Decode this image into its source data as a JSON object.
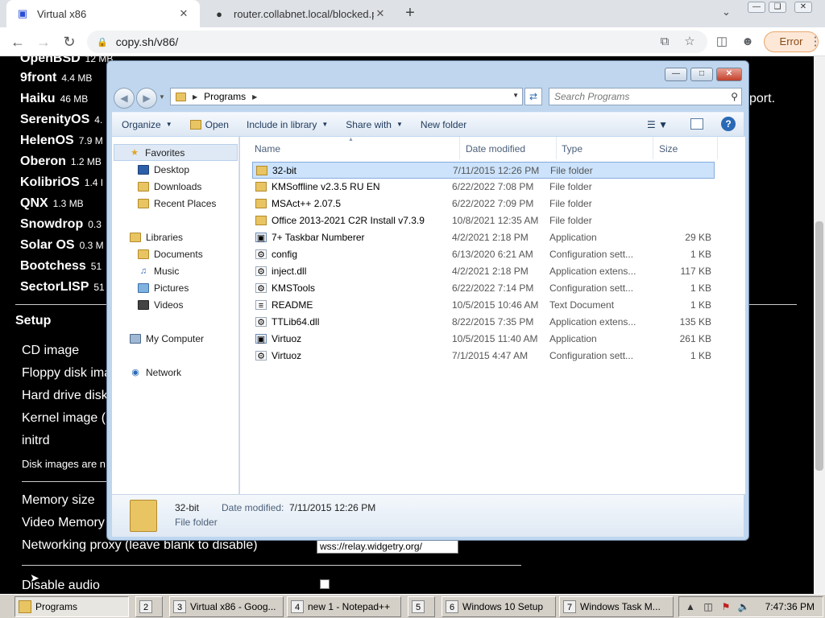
{
  "browser": {
    "tabs": [
      {
        "title": "Virtual x86",
        "favicon": "x86-icon"
      },
      {
        "title": "router.collabnet.local/blocked.ph",
        "favicon": "globe-icon"
      }
    ],
    "url": "copy.sh/v86/",
    "error_label": "Error"
  },
  "page": {
    "os_list": [
      {
        "name": "OpenBSD",
        "size": "12 MB"
      },
      {
        "name": "9front",
        "size": "4.4 MB"
      },
      {
        "name": "Haiku",
        "size": "46 MB"
      },
      {
        "name": "SerenityOS",
        "size": "4."
      },
      {
        "name": "HelenOS",
        "size": "7.9 M"
      },
      {
        "name": "Oberon",
        "size": "1.2 MB"
      },
      {
        "name": "KolibriOS",
        "size": "1.4 I"
      },
      {
        "name": "QNX",
        "size": "1.3 MB"
      },
      {
        "name": "Snowdrop",
        "size": "0.3"
      },
      {
        "name": "Solar OS",
        "size": "0.3 M"
      },
      {
        "name": "Bootchess",
        "size": "51"
      },
      {
        "name": "SectorLISP",
        "size": "51"
      }
    ],
    "right_fragment": "port.",
    "setup_heading": "Setup",
    "setup_rows": [
      "CD image",
      "Floppy disk ima",
      "Hard drive disk",
      "Kernel image (",
      "initrd",
      "Disk images are n",
      "Memory size",
      "Video Memory",
      "Networking proxy (leave blank to disable)",
      "Disable audio"
    ],
    "proxy_value": "wss://relay.widgetry.org/"
  },
  "explorer": {
    "breadcrumb": "Programs",
    "search_placeholder": "Search Programs",
    "commands": [
      "Organize",
      "Open",
      "Include in library",
      "Share with",
      "New folder"
    ],
    "nav": {
      "favorites": "Favorites",
      "desktop": "Desktop",
      "downloads": "Downloads",
      "recent": "Recent Places",
      "libraries": "Libraries",
      "documents": "Documents",
      "music": "Music",
      "pictures": "Pictures",
      "videos": "Videos",
      "computer": "My Computer",
      "network": "Network"
    },
    "columns": {
      "name": "Name",
      "date": "Date modified",
      "type": "Type",
      "size": "Size"
    },
    "files": [
      {
        "name": "32-bit",
        "date": "7/11/2015 12:26 PM",
        "type": "File folder",
        "size": "",
        "icon": "folder-icon"
      },
      {
        "name": "KMSoffline v2.3.5 RU EN",
        "date": "6/22/2022 7:08 PM",
        "type": "File folder",
        "size": "",
        "icon": "folder-icon"
      },
      {
        "name": "MSAct++ 2.07.5",
        "date": "6/22/2022 7:09 PM",
        "type": "File folder",
        "size": "",
        "icon": "folder-icon"
      },
      {
        "name": "Office 2013-2021 C2R Install v7.3.9",
        "date": "10/8/2021 12:35 AM",
        "type": "File folder",
        "size": "",
        "icon": "folder-icon"
      },
      {
        "name": "7+ Taskbar Numberer",
        "date": "4/2/2021 2:18 PM",
        "type": "Application",
        "size": "29 KB",
        "icon": "app-icon"
      },
      {
        "name": "config",
        "date": "6/13/2020 6:21 AM",
        "type": "Configuration sett...",
        "size": "1 KB",
        "icon": "settings-file-icon"
      },
      {
        "name": "inject.dll",
        "date": "4/2/2021 2:18 PM",
        "type": "Application extens...",
        "size": "117 KB",
        "icon": "dll-icon"
      },
      {
        "name": "KMSTools",
        "date": "6/22/2022 7:14 PM",
        "type": "Configuration sett...",
        "size": "1 KB",
        "icon": "settings-file-icon"
      },
      {
        "name": "README",
        "date": "10/5/2015 10:46 AM",
        "type": "Text Document",
        "size": "1 KB",
        "icon": "text-file-icon"
      },
      {
        "name": "TTLib64.dll",
        "date": "8/22/2015 7:35 PM",
        "type": "Application extens...",
        "size": "135 KB",
        "icon": "dll-icon"
      },
      {
        "name": "Virtuoz",
        "date": "10/5/2015 11:40 AM",
        "type": "Application",
        "size": "261 KB",
        "icon": "app-icon"
      },
      {
        "name": "Virtuoz",
        "date": "7/1/2015 4:47 AM",
        "type": "Configuration sett...",
        "size": "1 KB",
        "icon": "settings-file-icon"
      }
    ],
    "details": {
      "name": "32-bit",
      "type": "File folder",
      "modified_label": "Date modified:",
      "modified_value": "7/11/2015 12:26 PM"
    }
  },
  "taskbar": {
    "tasks": [
      {
        "label": "Programs",
        "num": ""
      },
      {
        "label": "",
        "num": "2"
      },
      {
        "label": "Virtual x86 - Goog...",
        "num": "3"
      },
      {
        "label": "new 1 - Notepad++",
        "num": "4"
      },
      {
        "label": "",
        "num": "5"
      },
      {
        "label": "Windows 10 Setup",
        "num": "6"
      },
      {
        "label": "Windows Task M...",
        "num": "7"
      }
    ],
    "clock": "7:47:36 PM"
  }
}
